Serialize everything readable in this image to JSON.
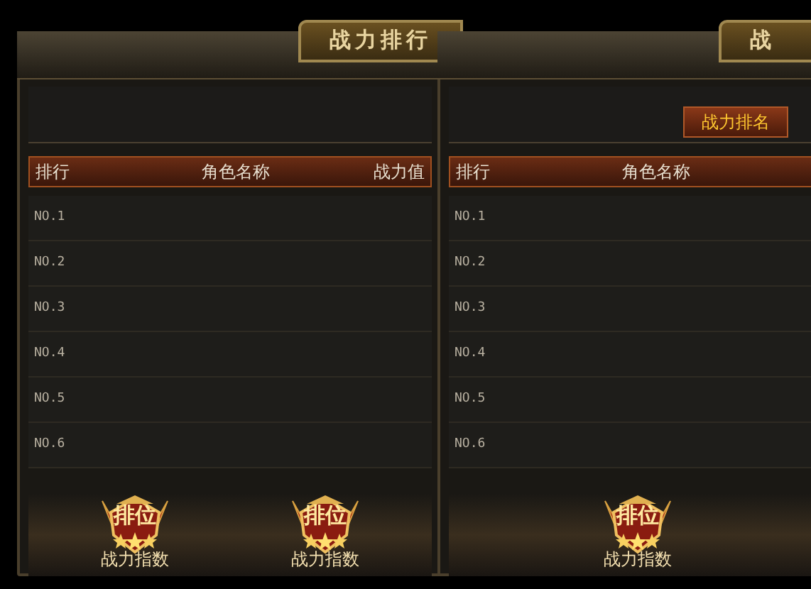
{
  "panels": [
    {
      "title": "战力排行",
      "columns": [
        "排行",
        "角色名称",
        "战力值"
      ],
      "rows": [
        "NO.1",
        "NO.2",
        "NO.3",
        "NO.4",
        "NO.5",
        "NO.6"
      ],
      "badges": [
        {
          "emblem": "排位",
          "caption": "战力指数"
        },
        {
          "emblem": "排位",
          "caption": "战力指数"
        }
      ]
    },
    {
      "title": "战",
      "tabs": [
        {
          "label": "战力排名",
          "selected": true
        }
      ],
      "columns": [
        "排行",
        "角色名称"
      ],
      "rows": [
        "NO.1",
        "NO.2",
        "NO.3",
        "NO.4",
        "NO.5",
        "NO.6"
      ],
      "badges": [
        {
          "emblem": "排位",
          "caption": "战力指数"
        }
      ]
    }
  ]
}
